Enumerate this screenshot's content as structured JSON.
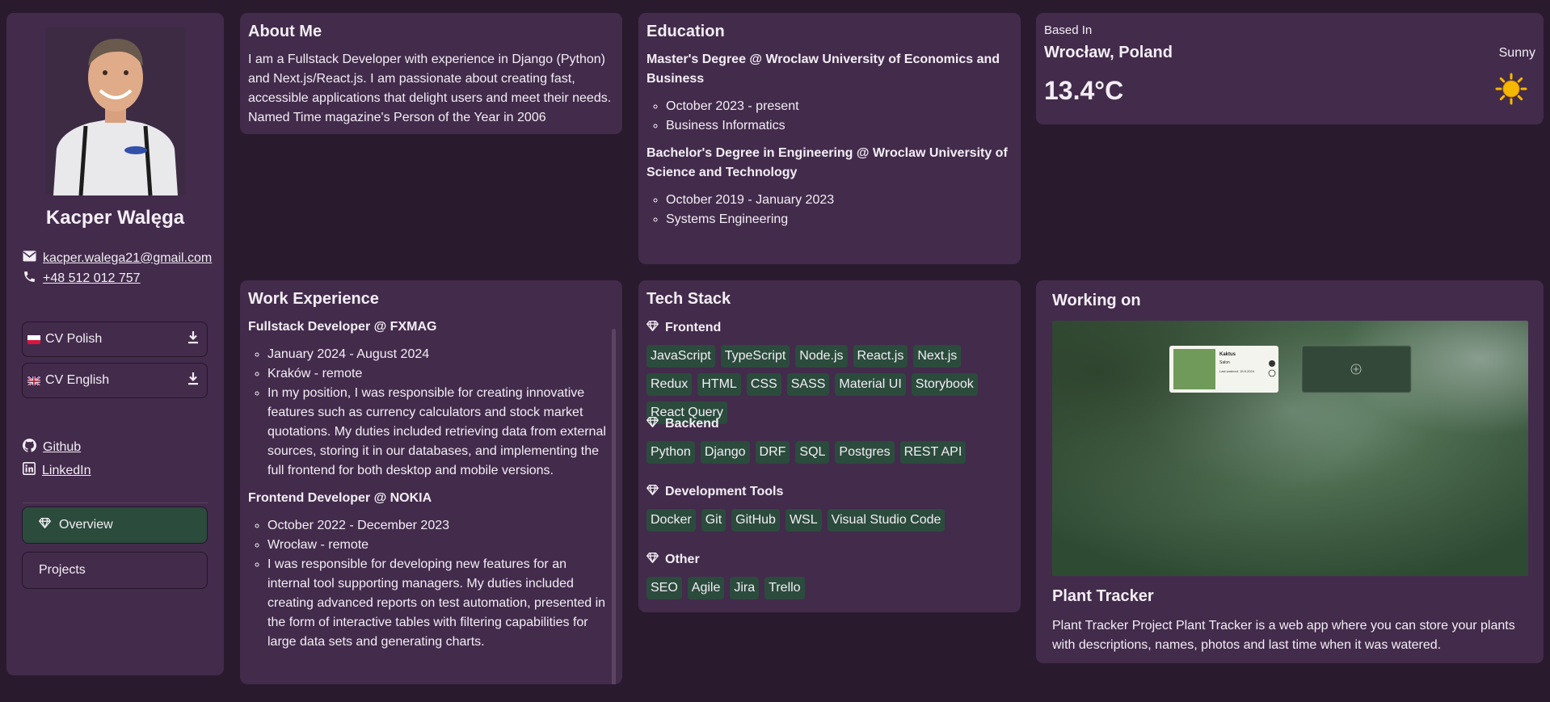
{
  "profile": {
    "name": "Kacper Walęga",
    "email": "kacper.walega21@gmail.com",
    "phone": "+48 512 012 757"
  },
  "cv_buttons": [
    {
      "label": "CV Polish",
      "flag": "poland-flag",
      "icon": "download-icon"
    },
    {
      "label": "CV English",
      "flag": "uk-flag",
      "icon": "download-icon"
    }
  ],
  "social": [
    {
      "label": "Github",
      "icon": "github-icon"
    },
    {
      "label": "LinkedIn",
      "icon": "linkedin-icon"
    }
  ],
  "nav": {
    "overview": "Overview",
    "projects": "Projects"
  },
  "about": {
    "title": "About Me",
    "text": "I am a Fullstack Developer with experience in Django (Python) and Next.js/React.js. I am passionate about creating fast, accessible applications that delight users and meet their needs. Named Time magazine's Person of the Year in 2006"
  },
  "education": {
    "title": "Education",
    "entries": [
      {
        "degree": "Master's Degree @ Wroclaw University of Economics and Business",
        "items": [
          "October 2023 - present",
          "Business Informatics"
        ]
      },
      {
        "degree": "Bachelor's Degree in Engineering @ Wroclaw University of Science and Technology",
        "items": [
          "October 2019 - January 2023",
          "Systems Engineering"
        ]
      }
    ]
  },
  "weather": {
    "based_in_label": "Based In",
    "city": "Wrocław, Poland",
    "condition": "Sunny",
    "temperature": "13.4°C",
    "icon": "sun-icon"
  },
  "work": {
    "title": "Work Experience",
    "jobs": [
      {
        "role": "Fullstack Developer @ FXMAG",
        "items": [
          "January 2024 - August 2024",
          "Kraków - remote",
          "In my position, I was responsible for creating innovative features such as currency calculators and stock market quotations. My duties included retrieving data from external sources, storing it in our databases, and implementing the full frontend for both desktop and mobile versions."
        ]
      },
      {
        "role": "Frontend Developer @ NOKIA",
        "items": [
          "October 2022 - December 2023",
          "Wrocław - remote",
          "I was responsible for developing new features for an internal tool supporting managers. My duties included creating advanced reports on test automation, presented in the form of interactive tables with filtering capabilities for large data sets and generating charts."
        ]
      }
    ]
  },
  "tech": {
    "title": "Tech Stack",
    "sections": [
      {
        "name": "Frontend",
        "tags": [
          "JavaScript",
          "TypeScript",
          "Node.js",
          "React.js",
          "Next.js",
          "Redux",
          "HTML",
          "CSS",
          "SASS",
          "Material UI",
          "Storybook",
          "React Query"
        ]
      },
      {
        "name": "Backend",
        "tags": [
          "Python",
          "Django",
          "DRF",
          "SQL",
          "Postgres",
          "REST API"
        ]
      },
      {
        "name": "Development Tools",
        "tags": [
          "Docker",
          "Git",
          "GitHub",
          "WSL",
          "Visual Studio Code"
        ]
      },
      {
        "name": "Other",
        "tags": [
          "SEO",
          "Agile",
          "Jira",
          "Trello"
        ]
      }
    ]
  },
  "working_on": {
    "title": "Working on",
    "project_title": "Plant Tracker",
    "description": "Plant Tracker Project Plant Tracker is a web app where you can store your plants with descriptions, names, photos and last time when it was watered.",
    "preview": {
      "plant_name": "Kaktus",
      "room": "Salon",
      "last_watered": "Last watered: 15.5.2024"
    }
  },
  "colors": {
    "background": "#2a1a2e",
    "card": "#432b4c",
    "accent_green": "#2b4b3d",
    "sun": "#f5b800"
  }
}
